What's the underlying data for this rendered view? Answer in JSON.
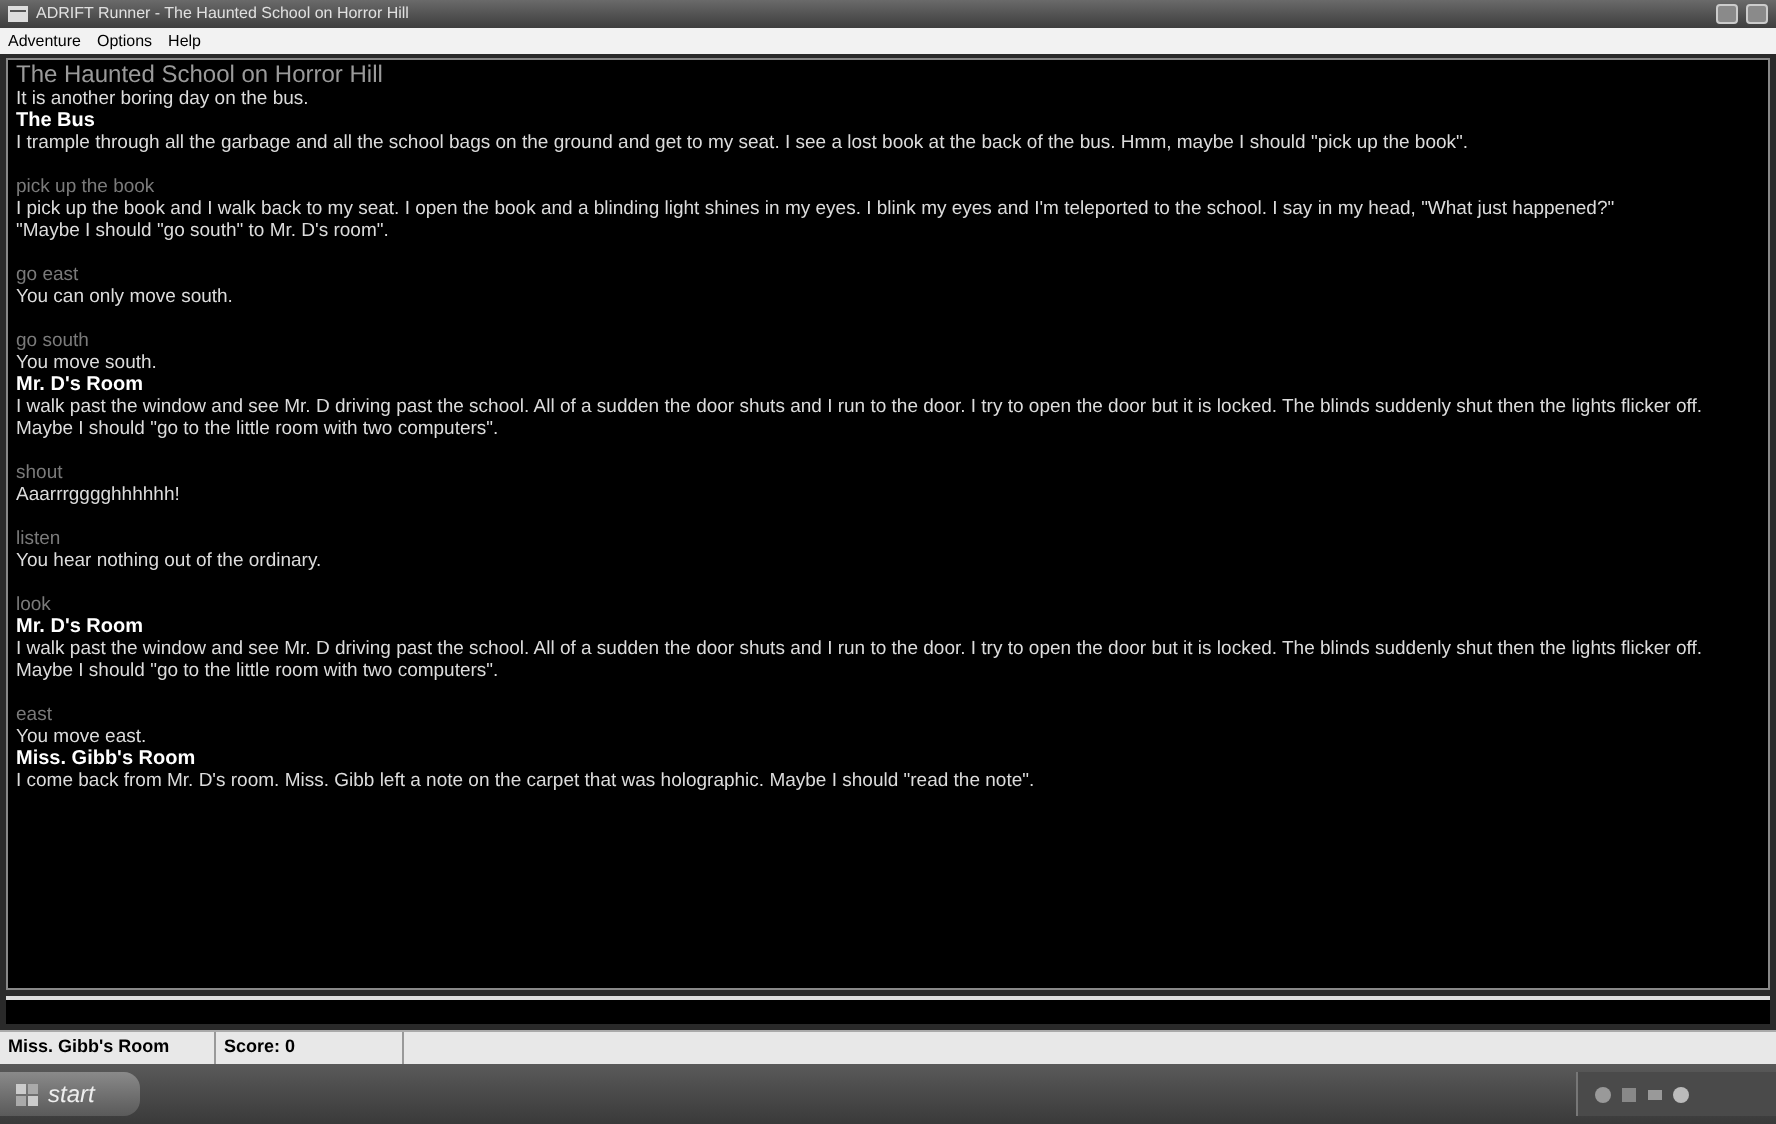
{
  "window": {
    "title": "ADRIFT Runner - The Haunted School on Horror Hill"
  },
  "menu": [
    "Adventure",
    "Options",
    "Help"
  ],
  "transcript": [
    {
      "kind": "title",
      "text": "The Haunted School on Horror Hill"
    },
    {
      "kind": "text",
      "text": "It is another boring day on the bus."
    },
    {
      "kind": "room",
      "text": "The Bus"
    },
    {
      "kind": "text",
      "text": "I trample through all the garbage and all the school bags on the ground and get to my seat.  I see a lost book at the back of the bus.  Hmm, maybe I should \"pick up the book\"."
    },
    {
      "kind": "command",
      "text": "pick up the book"
    },
    {
      "kind": "text",
      "text": "I pick up the book and I walk back to my seat.  I open the book and a blinding light shines in my eyes.  I blink my eyes and I'm teleported to the school.  I say in my head, \"What just happened?\""
    },
    {
      "kind": "text",
      "text": " \"Maybe I should \"go south\" to Mr. D's room\"."
    },
    {
      "kind": "command",
      "text": "go east"
    },
    {
      "kind": "text",
      "text": "You can only move south."
    },
    {
      "kind": "command",
      "text": "go south"
    },
    {
      "kind": "text",
      "text": "You move south."
    },
    {
      "kind": "room",
      "text": "Mr. D's Room"
    },
    {
      "kind": "text",
      "text": "I walk past the window and see Mr. D driving past the school. All of a sudden the door shuts and I run to the door.  I try to open the door but it is locked.  The blinds suddenly shut then the lights flicker off.  Maybe I should \"go to the little room with two computers\"."
    },
    {
      "kind": "command",
      "text": "shout"
    },
    {
      "kind": "text",
      "text": "Aaarrrgggghhhhhh!"
    },
    {
      "kind": "command",
      "text": "listen"
    },
    {
      "kind": "text",
      "text": "You hear nothing out of the ordinary."
    },
    {
      "kind": "command",
      "text": "look"
    },
    {
      "kind": "room",
      "text": "Mr. D's Room"
    },
    {
      "kind": "text",
      "text": "I walk past the window and see Mr. D driving past the school. All of a sudden the door shuts and I run to the door.  I try to open the door but it is locked.  The blinds suddenly shut then the lights flicker off.  Maybe I should \"go to the little room with two computers\"."
    },
    {
      "kind": "command",
      "text": "east"
    },
    {
      "kind": "text",
      "text": "You move east."
    },
    {
      "kind": "room",
      "text": "Miss. Gibb's Room"
    },
    {
      "kind": "text",
      "text": "I come back from Mr. D's room.  Miss. Gibb left a note on the carpet that was holographic.  Maybe I should \"read the note\"."
    }
  ],
  "status_bar": {
    "location": "Miss. Gibb's Room",
    "score": "Score: 0"
  },
  "taskbar": {
    "start": "start"
  }
}
